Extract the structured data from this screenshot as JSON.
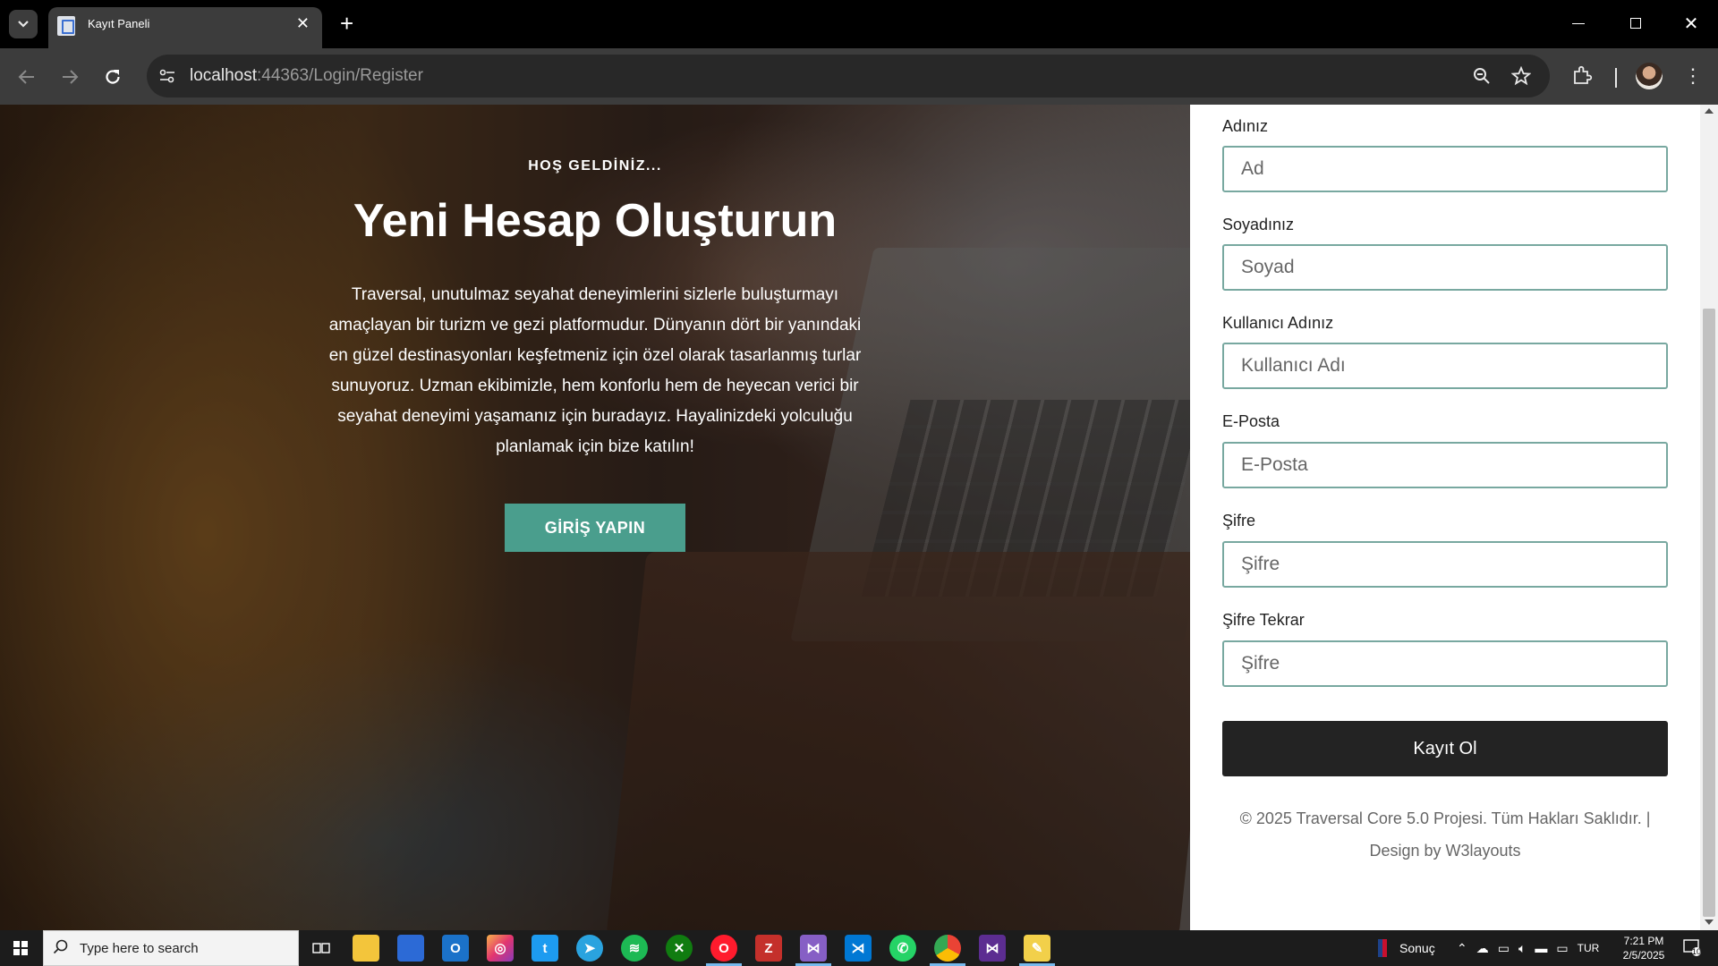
{
  "browser": {
    "tab_title": "Kayıt Paneli",
    "url_host": "localhost",
    "url_rest": ":44363/Login/Register"
  },
  "hero": {
    "eyebrow": "HOŞ GELDİNİZ...",
    "title": "Yeni Hesap Oluşturun",
    "description": "Traversal, unutulmaz seyahat deneyimlerini sizlerle buluşturmayı amaçlayan bir turizm ve gezi platformudur. Dünyanın dört bir yanındaki en güzel destinasyonları keşfetmeniz için özel olarak tasarlanmış turlar sunuyoruz. Uzman ekibimizle, hem konforlu hem de heyecan verici bir seyahat deneyimi yaşamanız için buradayız. Hayalinizdeki yolculuğu planlamak için bize katılın!",
    "login_button": "GİRİŞ YAPIN"
  },
  "form": {
    "fields": [
      {
        "label": "Adınız",
        "placeholder": "Ad",
        "value": ""
      },
      {
        "label": "Soyadınız",
        "placeholder": "Soyad",
        "value": ""
      },
      {
        "label": "Kullanıcı Adınız",
        "placeholder": "Kullanıcı Adı",
        "value": ""
      },
      {
        "label": "E-Posta",
        "placeholder": "E-Posta",
        "value": ""
      },
      {
        "label": "Şifre",
        "placeholder": "Şifre",
        "value": ""
      },
      {
        "label": "Şifre Tekrar",
        "placeholder": "Şifre",
        "value": ""
      }
    ],
    "submit_label": "Kayıt Ol",
    "footer_line1": "© 2025 Traversal Core 5.0 Projesi. Tüm Hakları Saklıdır. |",
    "footer_line2": "Design by W3layouts"
  },
  "taskbar": {
    "search_placeholder": "Type here to search",
    "weather_label": "Sonuç",
    "language": "TUR",
    "time": "7:21 PM",
    "date": "2/5/2025",
    "notification_count": "10",
    "apps": [
      "task-view",
      "file-explorer",
      "microsoft-store",
      "outlook",
      "instagram",
      "twitter",
      "telegram",
      "spotify",
      "xbox",
      "opera",
      "filezilla",
      "visual-studio",
      "vscode",
      "whatsapp",
      "chrome",
      "visual-studio-2",
      "paint"
    ]
  },
  "colors": {
    "accent_button": "#4a9e8d",
    "input_border": "#78a8a0",
    "submit_bg": "#232323"
  }
}
